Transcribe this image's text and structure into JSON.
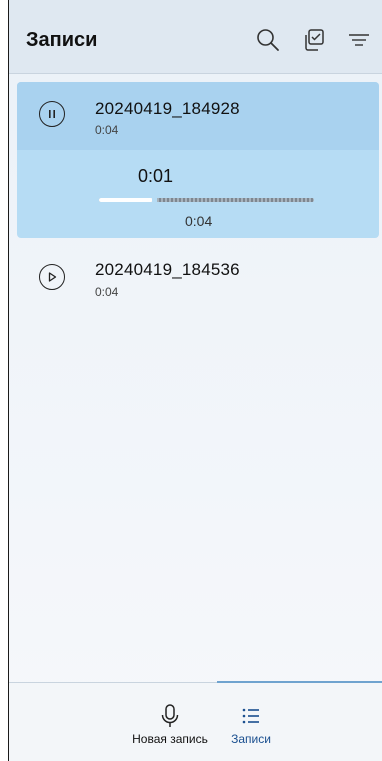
{
  "header": {
    "title": "Записи",
    "icons": [
      "search-icon",
      "select-icon",
      "filter-icon"
    ]
  },
  "recordings": [
    {
      "name": "20240419_184928",
      "duration": "0:04",
      "state": "playing",
      "player": {
        "current_time": "0:01",
        "total_time": "0:04",
        "progress": 0.25
      }
    },
    {
      "name": "20240419_184536",
      "duration": "0:04",
      "state": "stopped"
    }
  ],
  "bottom_nav": {
    "items": [
      {
        "label": "Новая запись",
        "icon": "microphone-icon",
        "active": false
      },
      {
        "label": "Записи",
        "icon": "list-icon",
        "active": true
      }
    ]
  },
  "colors": {
    "accent": "#1a4f8f",
    "selected_card": "#b6dcf4",
    "indicator": "#6fa3cf"
  }
}
